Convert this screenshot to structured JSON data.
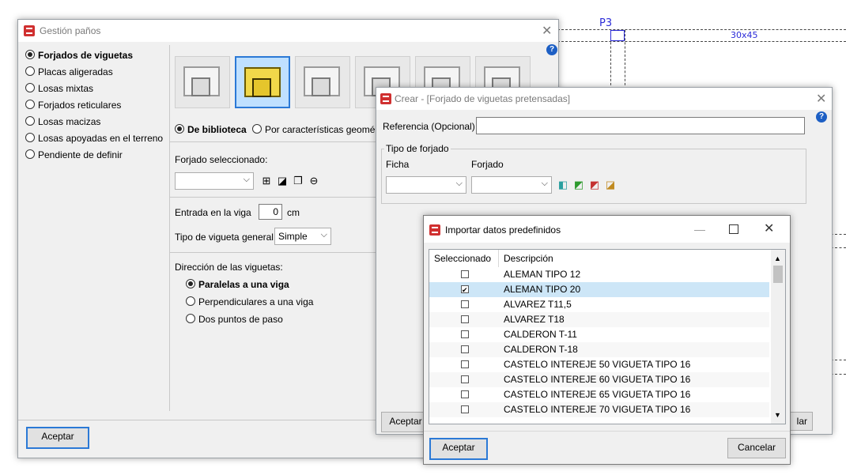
{
  "cad": {
    "column_label": "P3",
    "beam_label": "30x45"
  },
  "win1": {
    "title": "Gestión paños",
    "floor_types": [
      {
        "label": "Forjados de viguetas",
        "selected": true
      },
      {
        "label": "Placas aligeradas",
        "selected": false
      },
      {
        "label": "Losas mixtas",
        "selected": false
      },
      {
        "label": "Forjados reticulares",
        "selected": false
      },
      {
        "label": "Losas macizas",
        "selected": false
      },
      {
        "label": "Losas apoyadas en el terreno",
        "selected": false
      },
      {
        "label": "Pendiente de definir",
        "selected": false
      }
    ],
    "source_library": "De biblioteca",
    "source_geometric": "Por características geométricas",
    "selected_slab_label": "Forjado seleccionado:",
    "beam_entry_label": "Entrada en la viga",
    "beam_entry_value": "0",
    "beam_entry_unit": "cm",
    "joist_type_label": "Tipo de vigueta general",
    "joist_type_value": "Simple",
    "direction_label": "Dirección de las viguetas:",
    "directions": [
      {
        "label": "Paralelas a una viga",
        "selected": true
      },
      {
        "label": "Perpendiculares a una viga",
        "selected": false
      },
      {
        "label": "Dos puntos de paso",
        "selected": false
      }
    ],
    "accept": "Aceptar"
  },
  "win2": {
    "title": "Crear - [Forjado de viguetas pretensadas]",
    "reference_label": "Referencia (Opcional)",
    "reference_value": "",
    "group_label": "Tipo de forjado",
    "col_ficha": "Ficha",
    "col_forjado": "Forjado",
    "accept": "Aceptar",
    "cancel_partial": "lar"
  },
  "win3": {
    "title": "Importar datos predefinidos",
    "header_selected": "Seleccionado",
    "header_description": "Descripción",
    "rows": [
      {
        "checked": false,
        "desc": "ALEMAN TIPO 12"
      },
      {
        "checked": true,
        "desc": "ALEMAN TIPO 20"
      },
      {
        "checked": false,
        "desc": "ALVAREZ T11,5"
      },
      {
        "checked": false,
        "desc": "ALVAREZ T18"
      },
      {
        "checked": false,
        "desc": "CALDERON T-11"
      },
      {
        "checked": false,
        "desc": "CALDERON T-18"
      },
      {
        "checked": false,
        "desc": "CASTELO INTEREJE 50 VIGUETA TIPO 16"
      },
      {
        "checked": false,
        "desc": "CASTELO INTEREJE 60 VIGUETA TIPO 16"
      },
      {
        "checked": false,
        "desc": "CASTELO INTEREJE 65 VIGUETA TIPO 16"
      },
      {
        "checked": false,
        "desc": "CASTELO INTEREJE 70 VIGUETA TIPO 16"
      }
    ],
    "accept": "Aceptar",
    "cancel": "Cancelar"
  }
}
